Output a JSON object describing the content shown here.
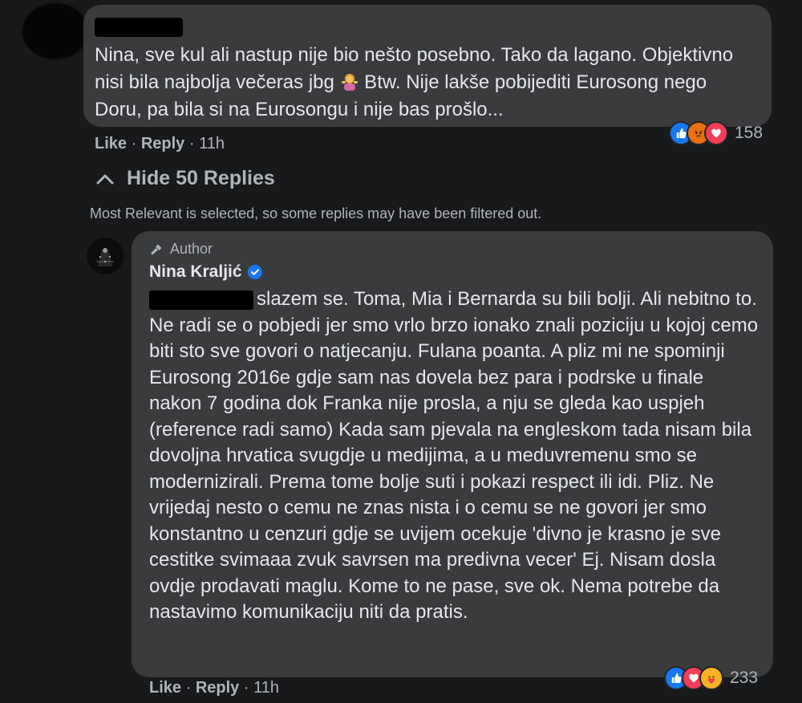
{
  "comment": {
    "text": "Nina, sve kul ali nastup nije bio nešto posebno. Tako da lagano. Objektivno nisi bila najbolja večeras jbg",
    "emoji": "person-shrugging-emoji",
    "text_after_emoji": " Btw. Nije lakše pobijediti Eurosong nego Doru, pa bila si na Eurosongu i nije bas prošlo...",
    "reaction_count": "158",
    "reactions": [
      "like-icon",
      "angry-icon",
      "love-icon"
    ],
    "like_label": "Like",
    "reply_label": "Reply",
    "time": "11h"
  },
  "replies_toggle": {
    "label": "Hide 50 Replies",
    "icon": "chevron-up-icon"
  },
  "filter_notice": "Most Relevant is selected, so some replies may have been filtered out.",
  "reply": {
    "badge": "Author",
    "name": "Nina Kraljić",
    "verified": true,
    "text": "slazem se. Toma, Mia i Bernarda su bili bolji. Ali nebitno to. Ne radi se o pobjedi jer smo vrlo brzo ionako znali poziciju u kojoj cemo biti sto sve govori o natjecanju. Fulana poanta. A pliz mi ne spominji Eurosong 2016e gdje sam nas dovela bez para i podrske u finale nakon 7 godina dok Franka nije prosla, a nju se gleda kao uspjeh (reference radi samo) Kada sam pjevala na engleskom tada nisam bila dovoljna hrvatica svugdje u medijima, a u meduvremenu smo se modernizirali. Prema tome bolje suti i pokazi respect ili idi. Pliz. Ne vrijedaj nesto o cemu ne znas nista i o cemu se ne govori jer smo konstantno u cenzuri gdje se uvijem ocekuje 'divno je krasno je sve cestitke svimaaa zvuk savrsen ma predivna vecer' Ej. Nisam dosla ovdje prodavati maglu. Kome to ne pase, sve ok. Nema potrebe da nastavimo komunikaciju niti da pratis.",
    "reaction_count": "233",
    "reactions": [
      "like-icon",
      "love-icon",
      "care-icon"
    ],
    "like_label": "Like",
    "reply_label": "Reply",
    "time": "11h"
  },
  "colors": {
    "background": "#18191a",
    "bubble": "#3a3b3c",
    "text": "#e4e6eb",
    "secondary_text": "#b0b3b8",
    "verified": "#1877f2"
  }
}
